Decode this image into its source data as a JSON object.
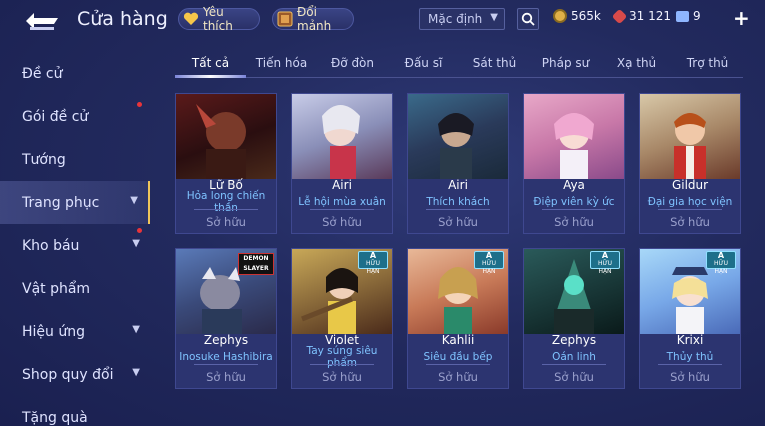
{
  "header": {
    "title": "Cửa hàng",
    "favorites_label": "Yêu thích",
    "exchange_label": "Đổi mảnh",
    "sort_select": "Mặc định",
    "currency": [
      {
        "icon": "gold-coin-icon",
        "value": "565k",
        "color": "#e0b048"
      },
      {
        "icon": "red-gem-icon",
        "value": "31 121",
        "color": "#d84a4a"
      },
      {
        "icon": "voucher-icon",
        "value": "9",
        "color": "#8fb6ff"
      }
    ]
  },
  "sidebar": {
    "items": [
      {
        "label": "Đề cử"
      },
      {
        "label": "Gói đề cử"
      },
      {
        "label": "Tướng"
      },
      {
        "label": "Trang phục"
      },
      {
        "label": "Kho báu"
      },
      {
        "label": "Vật phẩm"
      },
      {
        "label": "Hiệu ứng"
      },
      {
        "label": "Shop quy đổi"
      },
      {
        "label": "Tặng quà"
      }
    ]
  },
  "tabs": [
    {
      "label": "Tất cả"
    },
    {
      "label": "Tiến hóa"
    },
    {
      "label": "Đỡ đòn"
    },
    {
      "label": "Đấu sĩ"
    },
    {
      "label": "Sát thủ"
    },
    {
      "label": "Pháp sư"
    },
    {
      "label": "Xạ thủ"
    },
    {
      "label": "Trợ thủ"
    }
  ],
  "cards": [
    {
      "name": "Lữ Bố",
      "skin": "Hỏa long chiến thần",
      "status": "Sở hữu"
    },
    {
      "name": "Airi",
      "skin": "Lễ hội mùa xuân",
      "status": "Sở hữu"
    },
    {
      "name": "Airi",
      "skin": "Thích khách",
      "status": "Sở hữu"
    },
    {
      "name": "Aya",
      "skin": "Điệp viên kỳ ức",
      "status": "Sở hữu"
    },
    {
      "name": "Gildur",
      "skin": "Đại gia học viện",
      "status": "Sở hữu"
    },
    {
      "name": "Zephys",
      "skin": "Inosuke Hashibira",
      "status": "Sở hữu",
      "badge_text": "DEMON SLAYER"
    },
    {
      "name": "Violet",
      "skin": "Tay súng siêu phẩm",
      "status": "Sở hữu",
      "badge_tier": "A",
      "badge_text": "HỮU HẠN"
    },
    {
      "name": "Kahlii",
      "skin": "Siêu đầu bếp",
      "status": "Sở hữu",
      "badge_tier": "A",
      "badge_text": "HỮU HẠN"
    },
    {
      "name": "Zephys",
      "skin": "Oán linh",
      "status": "Sở hữu",
      "badge_tier": "A",
      "badge_text": "HỮU HẠN"
    },
    {
      "name": "Krixi",
      "skin": "Thủy thủ",
      "status": "Sở hữu",
      "badge_tier": "A",
      "badge_text": "HỮU HẠN"
    }
  ]
}
